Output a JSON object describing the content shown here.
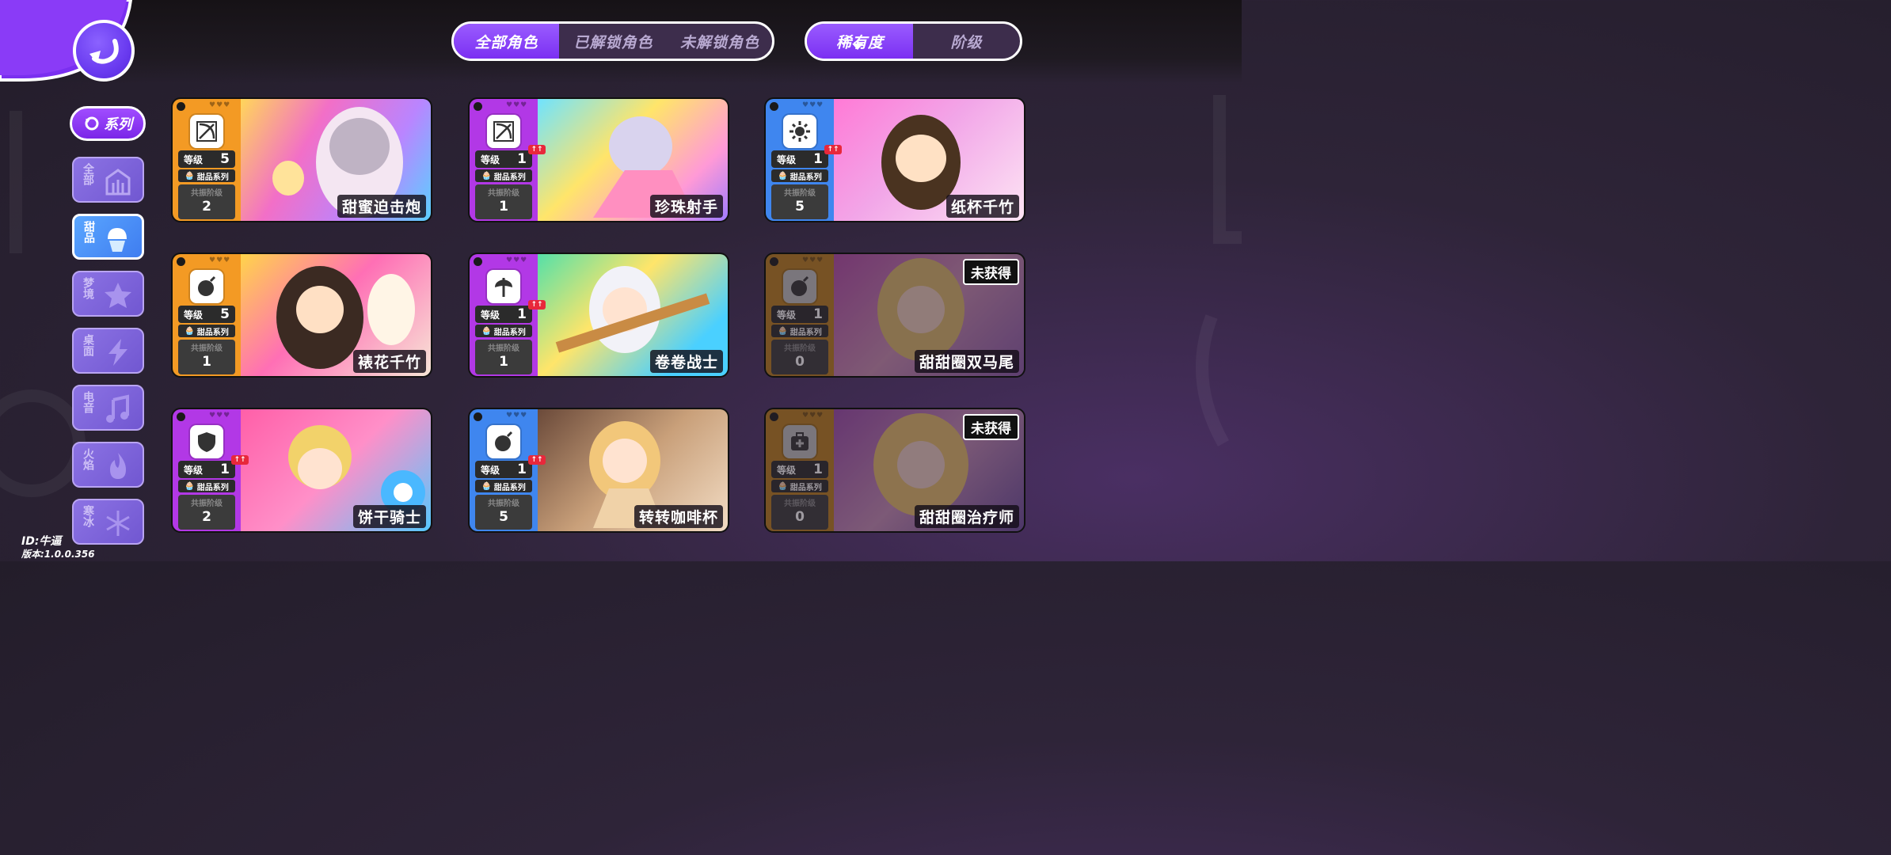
{
  "tabs": {
    "role": [
      "全部角色",
      "已解锁角色",
      "未解锁角色"
    ],
    "sort": [
      "稀有度",
      "阶级"
    ]
  },
  "series_header": "系列",
  "series": [
    {
      "label": "全部",
      "icon": "building-icon"
    },
    {
      "label": "甜品",
      "icon": "cupcake-icon",
      "active": true
    },
    {
      "label": "梦境",
      "icon": "star-icon"
    },
    {
      "label": "桌面",
      "icon": "lightning-icon"
    },
    {
      "label": "电音",
      "icon": "music-note-icon"
    },
    {
      "label": "火焰",
      "icon": "flame-icon"
    },
    {
      "label": "寒冰",
      "icon": "snowflake-icon"
    }
  ],
  "footer": {
    "id": "ID:牛逼",
    "version": "版本:1.0.0.356"
  },
  "card_labels": {
    "level": "等级",
    "series_tag": "甜品系列",
    "resonance": "共振阶级",
    "locked": "未获得",
    "up": "↑↑"
  },
  "cards": [
    {
      "name": "甜蜜迫击炮",
      "level": "5",
      "resonance": "2",
      "rarity": "orange",
      "role_icon": "bow-icon",
      "upgradable": false,
      "locked": false
    },
    {
      "name": "珍珠射手",
      "level": "1",
      "resonance": "1",
      "rarity": "purple",
      "role_icon": "bow-icon",
      "upgradable": true,
      "locked": false
    },
    {
      "name": "纸杯千竹",
      "level": "1",
      "resonance": "5",
      "rarity": "blue",
      "role_icon": "sun-gear-icon",
      "upgradable": true,
      "locked": false
    },
    {
      "name": "裱花千竹",
      "level": "5",
      "resonance": "1",
      "rarity": "orange",
      "role_icon": "bomb-icon",
      "upgradable": false,
      "locked": false
    },
    {
      "name": "卷卷战士",
      "level": "1",
      "resonance": "1",
      "rarity": "purple",
      "role_icon": "axe-icon",
      "upgradable": true,
      "locked": false
    },
    {
      "name": "甜甜圈双马尾",
      "level": "1",
      "resonance": "0",
      "rarity": "orange",
      "role_icon": "bomb-icon",
      "upgradable": false,
      "locked": true
    },
    {
      "name": "饼干骑士",
      "level": "1",
      "resonance": "2",
      "rarity": "purple",
      "role_icon": "shield-icon",
      "upgradable": true,
      "locked": false
    },
    {
      "name": "转转咖啡杯",
      "level": "1",
      "resonance": "5",
      "rarity": "blue",
      "role_icon": "bomb-icon",
      "upgradable": true,
      "locked": false
    },
    {
      "name": "甜甜圈治疗师",
      "level": "1",
      "resonance": "0",
      "rarity": "orange",
      "role_icon": "medkit-icon",
      "upgradable": false,
      "locked": true
    }
  ],
  "colors": {
    "orange": "#f39a24",
    "purple": "#b238e6",
    "blue": "#3f86ef",
    "accent": "#7b2ff2"
  }
}
